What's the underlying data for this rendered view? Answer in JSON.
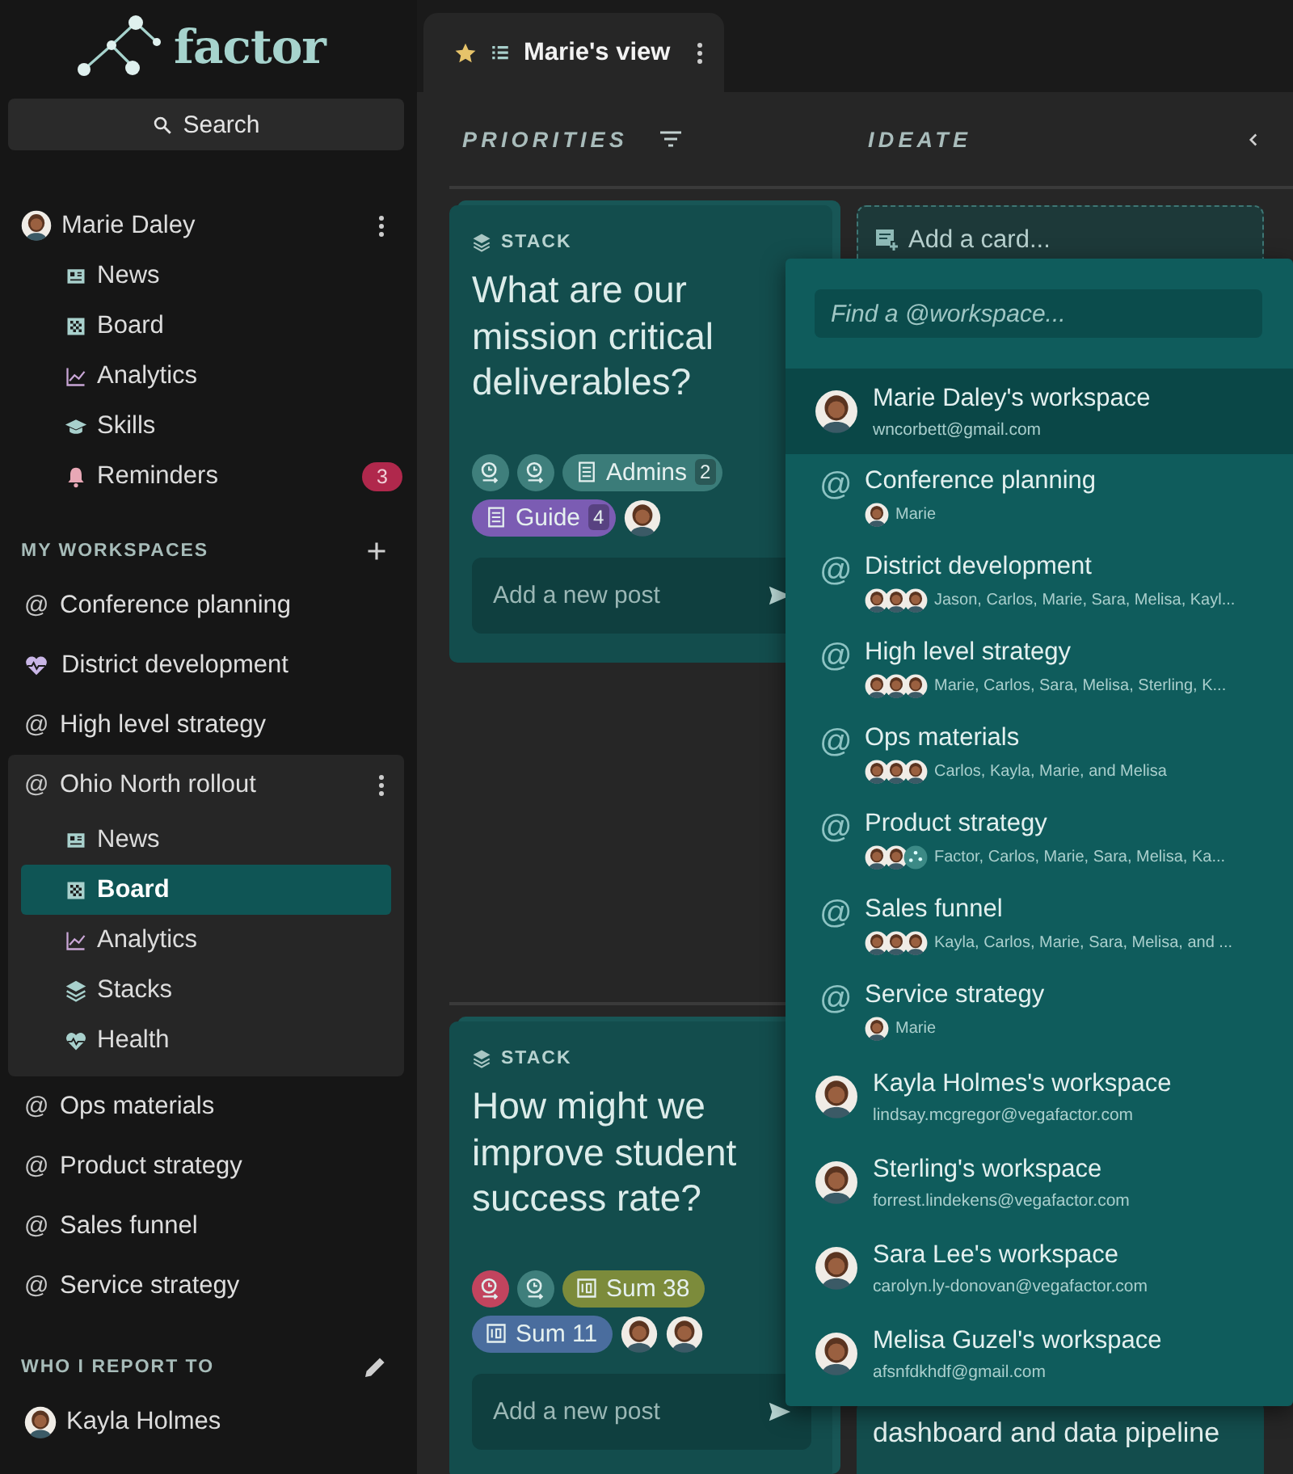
{
  "sidebar": {
    "logo": "factor",
    "search": {
      "label": "Search"
    },
    "user": {
      "name": "Marie Daley",
      "items": [
        {
          "label": "News",
          "selected": false
        },
        {
          "label": "Board",
          "selected": false
        },
        {
          "label": "Analytics",
          "selected": false
        },
        {
          "label": "Skills",
          "selected": false
        },
        {
          "label": "Reminders",
          "selected": false,
          "badge": "3"
        }
      ]
    },
    "workspaces_heading": "MY WORKSPACES",
    "workspaces": [
      {
        "symbol": "@",
        "label": "Conference planning",
        "expanded": false
      },
      {
        "label": "District development",
        "expanded": false
      },
      {
        "symbol": "@",
        "label": "High level strategy",
        "expanded": false
      },
      {
        "symbol": "@",
        "label": "Ohio North rollout",
        "expanded": true,
        "items": [
          {
            "label": "News",
            "selected": false
          },
          {
            "label": "Board",
            "selected": true
          },
          {
            "label": "Analytics",
            "selected": false
          },
          {
            "label": "Stacks",
            "selected": false
          },
          {
            "label": "Health",
            "selected": false
          }
        ]
      },
      {
        "symbol": "@",
        "label": "Ops materials",
        "expanded": false
      },
      {
        "symbol": "@",
        "label": "Product strategy",
        "expanded": false
      },
      {
        "symbol": "@",
        "label": "Sales funnel",
        "expanded": false
      },
      {
        "symbol": "@",
        "label": "Service strategy",
        "expanded": false
      }
    ],
    "report_heading": "WHO I REPORT TO",
    "reports_to": [
      {
        "name": "Kayla Holmes"
      }
    ]
  },
  "view_tab": {
    "title": "Marie's view",
    "starred": true
  },
  "board": {
    "columns": [
      {
        "title": "PRIORITIES",
        "cards": [
          {
            "kind": "stack",
            "label": "STACK",
            "title": "What are our mission critical deliverables?",
            "placeholder": "Add a new post",
            "tag_rows": [
              [
                {
                  "kind": "timer",
                  "color": "#3f7f7c"
                },
                {
                  "kind": "timer",
                  "color": "#3f7f7c"
                },
                {
                  "kind": "document",
                  "label": "Admins",
                  "count": "2",
                  "color": "#3b7c79"
                }
              ],
              [
                {
                  "kind": "document",
                  "label": "Guide",
                  "count": "4",
                  "color": "#7b5cb3"
                },
                {
                  "kind": "avatar"
                }
              ]
            ]
          },
          {
            "kind": "stack",
            "label": "STACK",
            "title": "How might we improve student success rate?",
            "placeholder": "Add a new post",
            "tag_rows": [
              [
                {
                  "kind": "timer",
                  "color": "#c2445e"
                },
                {
                  "kind": "timer",
                  "color": "#3f7f7c"
                },
                {
                  "kind": "calendar",
                  "label": "Sum 38",
                  "color": "#7c8b3b"
                }
              ],
              [
                {
                  "kind": "calendar",
                  "label": "Sum 11",
                  "color": "#4a6d9e"
                },
                {
                  "kind": "avatar"
                },
                {
                  "kind": "avatar"
                }
              ]
            ]
          }
        ]
      },
      {
        "title": "IDEATE",
        "add_card": "Add a card...",
        "cards": [
          {
            "kind": "task",
            "title": "dashboard and data pipeline"
          }
        ]
      }
    ]
  },
  "dropdown": {
    "placeholder": "Find a @workspace...",
    "items": [
      {
        "kind": "person",
        "title": "Marie Daley's workspace",
        "subtitle": "wncorbett@gmail.com",
        "selected": true
      },
      {
        "kind": "workspace",
        "symbol": "@",
        "title": "Conference planning",
        "members": "Marie",
        "avatars": [
          {
            "kind": "person"
          }
        ],
        "selected": false
      },
      {
        "kind": "workspace",
        "symbol": "@",
        "title": "District development",
        "members": "Jason, Carlos, Marie, Sara, Melisa, Kayl...",
        "avatars": [
          {
            "kind": "person"
          },
          {
            "kind": "person"
          },
          {
            "kind": "person"
          }
        ],
        "selected": false
      },
      {
        "kind": "workspace",
        "symbol": "@",
        "title": "High level strategy",
        "members": "Marie, Carlos, Sara, Melisa, Sterling, K...",
        "avatars": [
          {
            "kind": "person"
          },
          {
            "kind": "person"
          },
          {
            "kind": "person"
          }
        ],
        "selected": false
      },
      {
        "kind": "workspace",
        "symbol": "@",
        "title": "Ops materials",
        "members": "Carlos, Kayla, Marie, and Melisa",
        "avatars": [
          {
            "kind": "person"
          },
          {
            "kind": "person"
          },
          {
            "kind": "person"
          }
        ],
        "selected": false
      },
      {
        "kind": "workspace",
        "symbol": "@",
        "title": "Product strategy",
        "members": "Factor, Carlos, Marie, Sara, Melisa, Ka...",
        "avatars": [
          {
            "kind": "person"
          },
          {
            "kind": "person"
          },
          {
            "kind": "logo"
          }
        ],
        "selected": false
      },
      {
        "kind": "workspace",
        "symbol": "@",
        "title": "Sales funnel",
        "members": "Kayla, Carlos, Marie, Sara, Melisa, and ...",
        "avatars": [
          {
            "kind": "person"
          },
          {
            "kind": "person"
          },
          {
            "kind": "person"
          }
        ],
        "selected": false
      },
      {
        "kind": "workspace",
        "symbol": "@",
        "title": "Service strategy",
        "members": "Marie",
        "avatars": [
          {
            "kind": "person"
          }
        ],
        "selected": false
      },
      {
        "kind": "person",
        "title": "Kayla Holmes's workspace",
        "subtitle": "lindsay.mcgregor@vegafactor.com",
        "selected": false
      },
      {
        "kind": "person",
        "title": "Sterling's workspace",
        "subtitle": "forrest.lindekens@vegafactor.com",
        "selected": false
      },
      {
        "kind": "person",
        "title": "Sara Lee's workspace",
        "subtitle": "carolyn.ly-donovan@vegafactor.com",
        "selected": false
      },
      {
        "kind": "person",
        "title": "Melisa Guzel's workspace",
        "subtitle": "afsnfdkhdf@gmail.com",
        "selected": false
      }
    ]
  }
}
